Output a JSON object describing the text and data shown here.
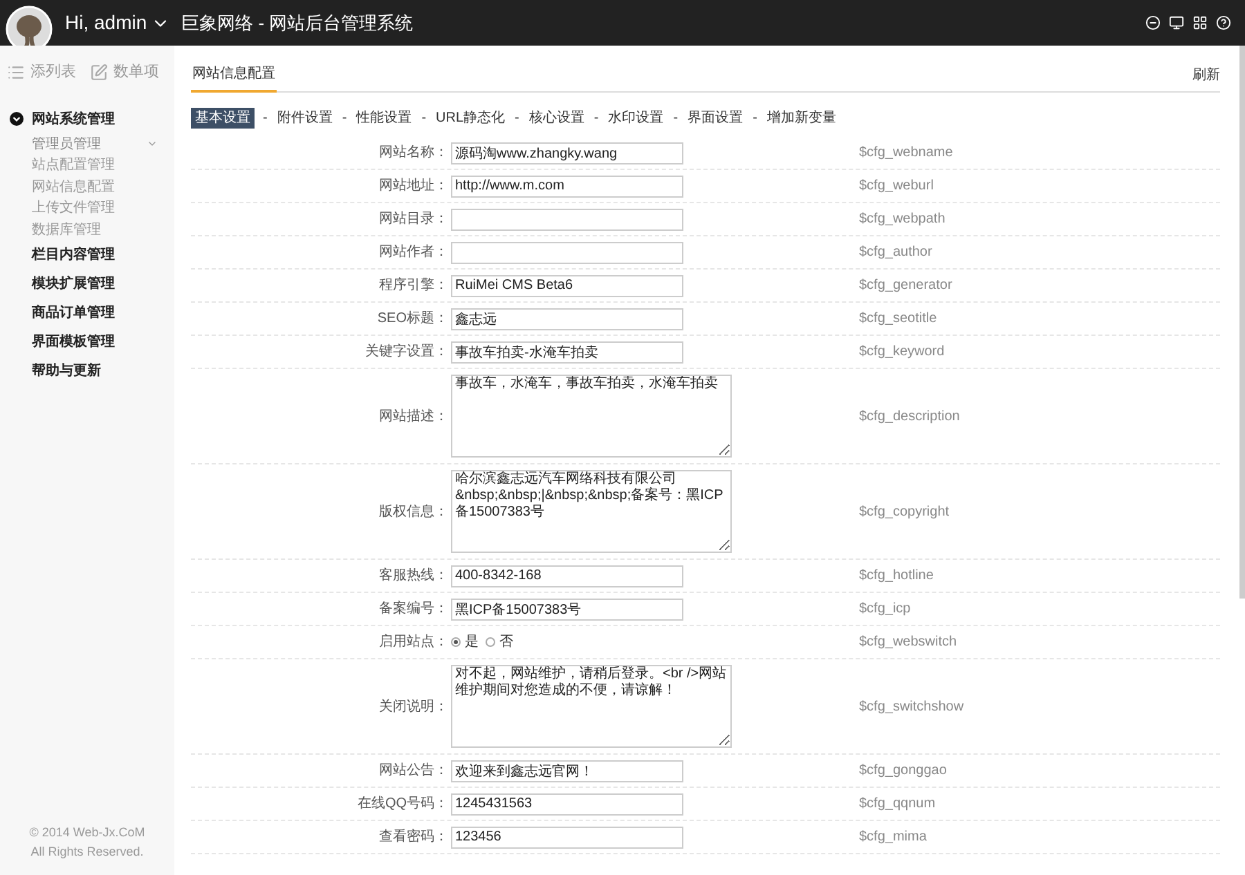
{
  "header": {
    "greeting": "Hi, admin",
    "title": "巨象网络 - 网站后台管理系统"
  },
  "sidebar": {
    "toolbar": [
      "添列表",
      "数单项"
    ],
    "sections": [
      {
        "label": "网站系统管理",
        "expanded": true,
        "children": [
          {
            "label": "管理员管理",
            "selected": true
          },
          {
            "label": "站点配置管理",
            "selected": false
          },
          {
            "label": "网站信息配置",
            "selected": false
          },
          {
            "label": "上传文件管理",
            "selected": false
          },
          {
            "label": "数据库管理",
            "selected": false
          }
        ]
      },
      {
        "label": "栏目内容管理",
        "expanded": false
      },
      {
        "label": "模块扩展管理",
        "expanded": false
      },
      {
        "label": "商品订单管理",
        "expanded": false
      },
      {
        "label": "界面模板管理",
        "expanded": false
      },
      {
        "label": "帮助与更新",
        "expanded": false
      }
    ],
    "footer": [
      "© 2014 Web-Jx.CoM",
      "All Rights Reserved."
    ]
  },
  "page": {
    "title": "网站信息配置",
    "refresh": "刷新"
  },
  "tabs": [
    {
      "label": "基本设置",
      "selected": true
    },
    {
      "separator": "-",
      "label": "附件设置",
      "selected": false
    },
    {
      "separator": "-",
      "label": "性能设置",
      "selected": false
    },
    {
      "separator": "-",
      "label": "URL静态化",
      "selected": false
    },
    {
      "separator": "-",
      "label": "核心设置",
      "selected": false
    },
    {
      "separator": "-",
      "label": "水印设置",
      "selected": false
    },
    {
      "separator": "-",
      "label": "界面设置",
      "selected": false
    },
    {
      "separator": "-",
      "label": "增加新变量",
      "selected": false
    }
  ],
  "fields": [
    {
      "kind": "text",
      "label": "网站名称：",
      "value": "源码淘www.zhangky.wang",
      "variable": "$cfg_webname"
    },
    {
      "kind": "text",
      "label": "网站地址：",
      "value": "http://www.m.com",
      "variable": "$cfg_weburl"
    },
    {
      "kind": "text",
      "label": "网站目录：",
      "variable": "$cfg_webpath"
    },
    {
      "kind": "text",
      "label": "网站作者：",
      "variable": "$cfg_author"
    },
    {
      "kind": "text",
      "label": "程序引擎：",
      "value": "RuiMei CMS Beta6",
      "variable": "$cfg_generator"
    },
    {
      "kind": "text",
      "label": "SEO标题：",
      "value": "鑫志远",
      "variable": "$cfg_seotitle"
    },
    {
      "kind": "text",
      "label": "关键字设置：",
      "value": "事故车拍卖-水淹车拍卖",
      "variable": "$cfg_keyword"
    },
    {
      "kind": "textarea",
      "label": "网站描述：",
      "value": "事故车，水淹车，事故车拍卖，水淹车拍卖",
      "variable": "$cfg_description"
    },
    {
      "kind": "textarea",
      "label": "版权信息：",
      "value": "哈尔滨鑫志远汽车网络科技有限公司&nbsp;&nbsp;|&nbsp;&nbsp;备案号：黑ICP备15007383号",
      "variable": "$cfg_copyright"
    },
    {
      "kind": "text",
      "label": "客服热线：",
      "value": "400-8342-168",
      "variable": "$cfg_hotline"
    },
    {
      "kind": "text",
      "label": "备案编号：",
      "value": "黑ICP备15007383号",
      "variable": "$cfg_icp"
    },
    {
      "kind": "radio",
      "label": "启用站点：",
      "options": [
        {
          "label": "是",
          "selected": true
        },
        {
          "label": "否",
          "selected": false
        }
      ],
      "variable": "$cfg_webswitch"
    },
    {
      "kind": "textarea",
      "label": "关闭说明：",
      "value": "对不起，网站维护，请稍后登录。<br />网站维护期间对您造成的不便，请谅解！",
      "variable": "$cfg_switchshow"
    },
    {
      "kind": "text",
      "label": "网站公告：",
      "value": "欢迎来到鑫志远官网！",
      "variable": "$cfg_gonggao"
    },
    {
      "kind": "text",
      "label": "在线QQ号码：",
      "value": "1245431563",
      "variable": "$cfg_qqnum"
    },
    {
      "kind": "text",
      "label": "查看密码：",
      "value": "123456",
      "variable": "$cfg_mima"
    }
  ]
}
